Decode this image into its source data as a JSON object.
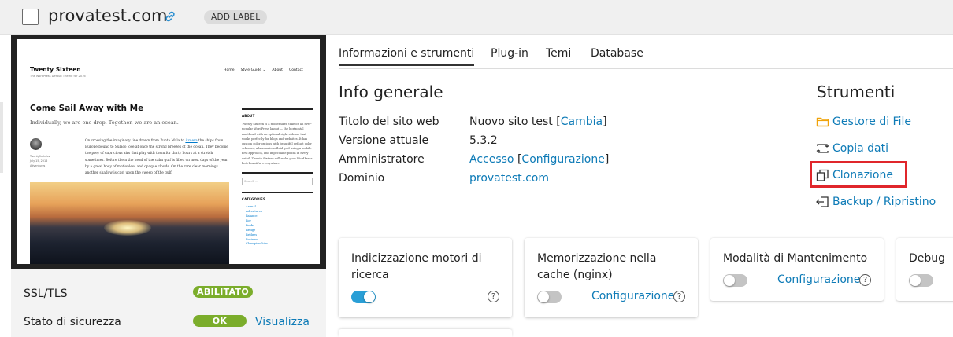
{
  "header": {
    "title": "provatest.com",
    "add_label": "ADD LABEL"
  },
  "preview": {
    "site_title": "Twenty Sixteen",
    "tagline": "The WordPress Default Theme for 2016",
    "nav": [
      "Home",
      "Style Guide ⌄",
      "About",
      "Contact"
    ],
    "post_title": "Come Sail Away with Me",
    "post_subtitle": "Individually, we are one drop. Together, we are an ocean.",
    "meta": [
      "Twentyfix Infos",
      "July 15, 2016",
      "Adventures"
    ],
    "body_pre": "On crossing the imaginary line drawn from Punta Mala to ",
    "body_link": "Azuera",
    "body_post": " the ships from Europe bound to Sulaco lose at once the strong breezes of the ocean. They become the prey of capricious airs that play with them for thirty hours at a stretch sometimes. Before them the head of the calm gulf is filled on most days of the year by a great body of motionless and opaque clouds. On the rare clear mornings another shadow is cast upon the sweep of the gulf.",
    "about_heading": "ABOUT",
    "about_text": "Twenty Sixteen is a modernized take on an ever-popular WordPress layout — the horizontal masthead with an optional right sidebar that works perfectly for blogs and websites. It has custom color options with beautiful default color schemes, a harmonious fluid grid using a mobile-first approach, and impeccable polish in every detail. Twenty Sixteen will make your WordPress look beautiful everywhere.",
    "search_placeholder": "Search ...",
    "categories_heading": "CATEGORIES",
    "categories": [
      "Animal",
      "Adventures",
      "Balance",
      "Boy",
      "Books",
      "Bridge",
      "Bridges",
      "Business",
      "Championships"
    ]
  },
  "left_rows": [
    {
      "label": "SSL/TLS",
      "badge": "ABILITATO"
    },
    {
      "label": "Stato di sicurezza",
      "badge": "OK",
      "link": "Visualizza"
    }
  ],
  "tabs": [
    "Informazioni e strumenti",
    "Plug-in",
    "Temi",
    "Database"
  ],
  "info": {
    "heading": "Info generale",
    "rows": [
      {
        "label": "Titolo del sito web",
        "value": "Nuovo sito test",
        "bracket_link": "Cambia"
      },
      {
        "label": "Versione attuale",
        "value": "5.3.2"
      },
      {
        "label": "Amministratore",
        "link": "Accesso",
        "bracket_link": "Configurazione"
      },
      {
        "label": "Dominio",
        "link": "provatest.com"
      }
    ]
  },
  "tools": {
    "heading": "Strumenti",
    "items": [
      "Gestore di File",
      "Copia dati",
      "Clonazione",
      "Backup / Ripristino"
    ]
  },
  "cards": [
    {
      "title": "Indicizzazione motori di ricerca",
      "toggle_on": true
    },
    {
      "title": "Memorizzazione nella cache (nginx)",
      "toggle_on": false,
      "link": "Configurazione"
    },
    {
      "title": "Modalità di Mantenimento",
      "toggle_on": false,
      "link": "Configurazione"
    },
    {
      "title": "Debug",
      "toggle_on": false
    }
  ],
  "colors": {
    "link": "#0e7bb7",
    "badge_green": "#7bad2b",
    "toggle_on": "#2a9fd6",
    "highlight": "#e0262b",
    "folder": "#f0a30a"
  }
}
